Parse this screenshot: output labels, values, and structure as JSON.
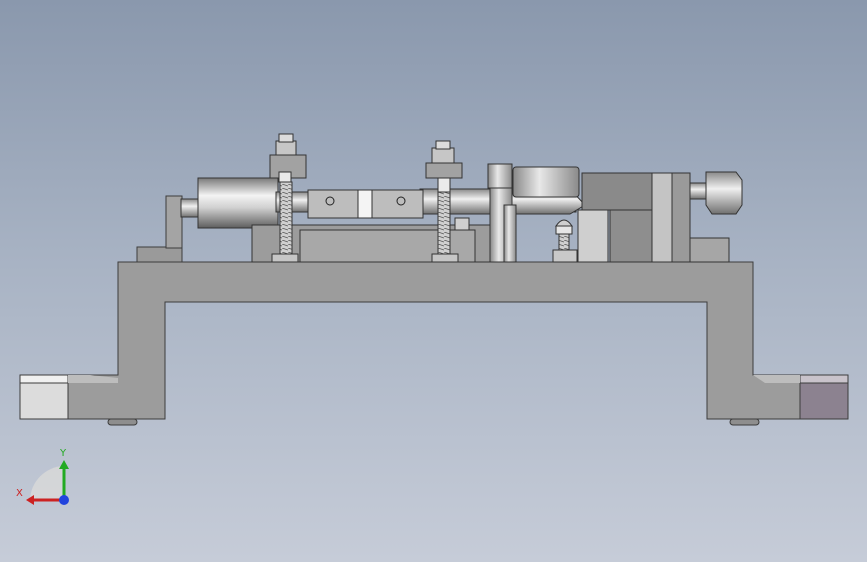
{
  "viewport": {
    "background_top": "#8a98ad",
    "background_bottom": "#c6ccd8",
    "model_colors": {
      "base": "#9a9a9a",
      "base_edge": "#444444",
      "foot_light": "#d8d8d8",
      "foot_dark": "#8a7f8a",
      "cylinder_light": "#f2f2f2",
      "cylinder_dark": "#6e6e6e"
    }
  },
  "triad": {
    "x_label": "X",
    "y_label": "Y",
    "x_color": "#cc2222",
    "y_color": "#22aa22",
    "z_color": "#2244dd"
  }
}
